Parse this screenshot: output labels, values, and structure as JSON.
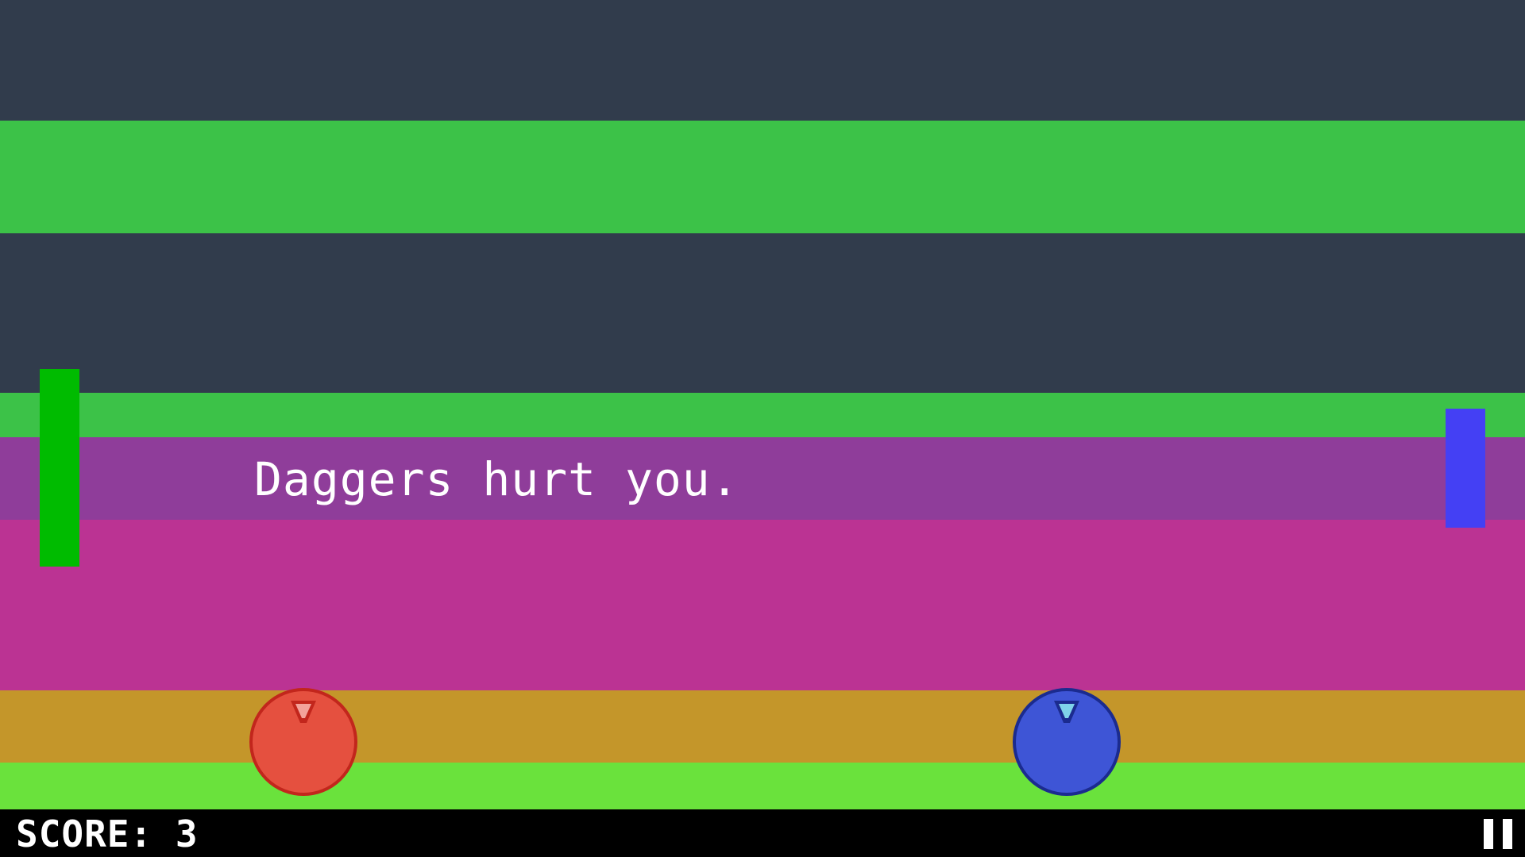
{
  "colors": {
    "dark_band": "#313c4c",
    "green_band": "#3cc248",
    "purple_band": "#8f3d9a",
    "magenta_band": "#bb3393",
    "gold_band": "#c4962a",
    "lime_band": "#6ae23c",
    "left_paddle": "#00bb00",
    "right_paddle": "#4440f4",
    "red_ball": "#e5503f",
    "blue_ball": "#3e55d6",
    "hud_bg": "#000000",
    "text": "#ffffff"
  },
  "game": {
    "message": "Daggers hurt you."
  },
  "hud": {
    "score_label": "SCORE: 3",
    "pause_icon": "pause-icon"
  }
}
